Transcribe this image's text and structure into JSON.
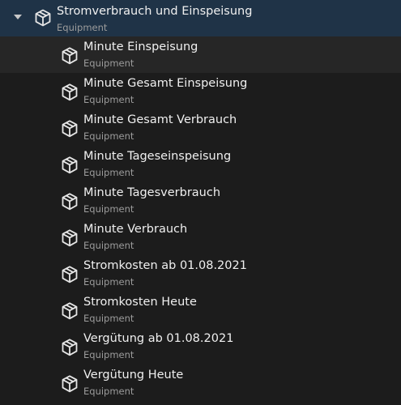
{
  "tree": {
    "parent": {
      "title": "Stromverbrauch und Einspeisung",
      "subtitle": "Equipment",
      "expander_icon": "chevron-down-icon",
      "icon": "cube-icon"
    },
    "children": [
      {
        "title": "Minute Einspeisung",
        "subtitle": "Equipment",
        "icon": "cube-icon"
      },
      {
        "title": "Minute Gesamt Einspeisung",
        "subtitle": "Equipment",
        "icon": "cube-icon"
      },
      {
        "title": "Minute Gesamt Verbrauch",
        "subtitle": "Equipment",
        "icon": "cube-icon"
      },
      {
        "title": "Minute Tageseinspeisung",
        "subtitle": "Equipment",
        "icon": "cube-icon"
      },
      {
        "title": "Minute Tagesverbrauch",
        "subtitle": "Equipment",
        "icon": "cube-icon"
      },
      {
        "title": "Minute Verbrauch",
        "subtitle": "Equipment",
        "icon": "cube-icon"
      },
      {
        "title": "Stromkosten ab 01.08.2021",
        "subtitle": "Equipment",
        "icon": "cube-icon"
      },
      {
        "title": "Stromkosten Heute",
        "subtitle": "Equipment",
        "icon": "cube-icon"
      },
      {
        "title": "Vergütung ab 01.08.2021",
        "subtitle": "Equipment",
        "icon": "cube-icon"
      },
      {
        "title": "Vergütung Heute",
        "subtitle": "Equipment",
        "icon": "cube-icon"
      }
    ]
  },
  "colors": {
    "background": "#1c1c1c",
    "selected_parent": "#1f3347",
    "hover_row": "#262626",
    "title_text": "#f0f0f0",
    "subtitle_text": "#9c9c9c"
  }
}
